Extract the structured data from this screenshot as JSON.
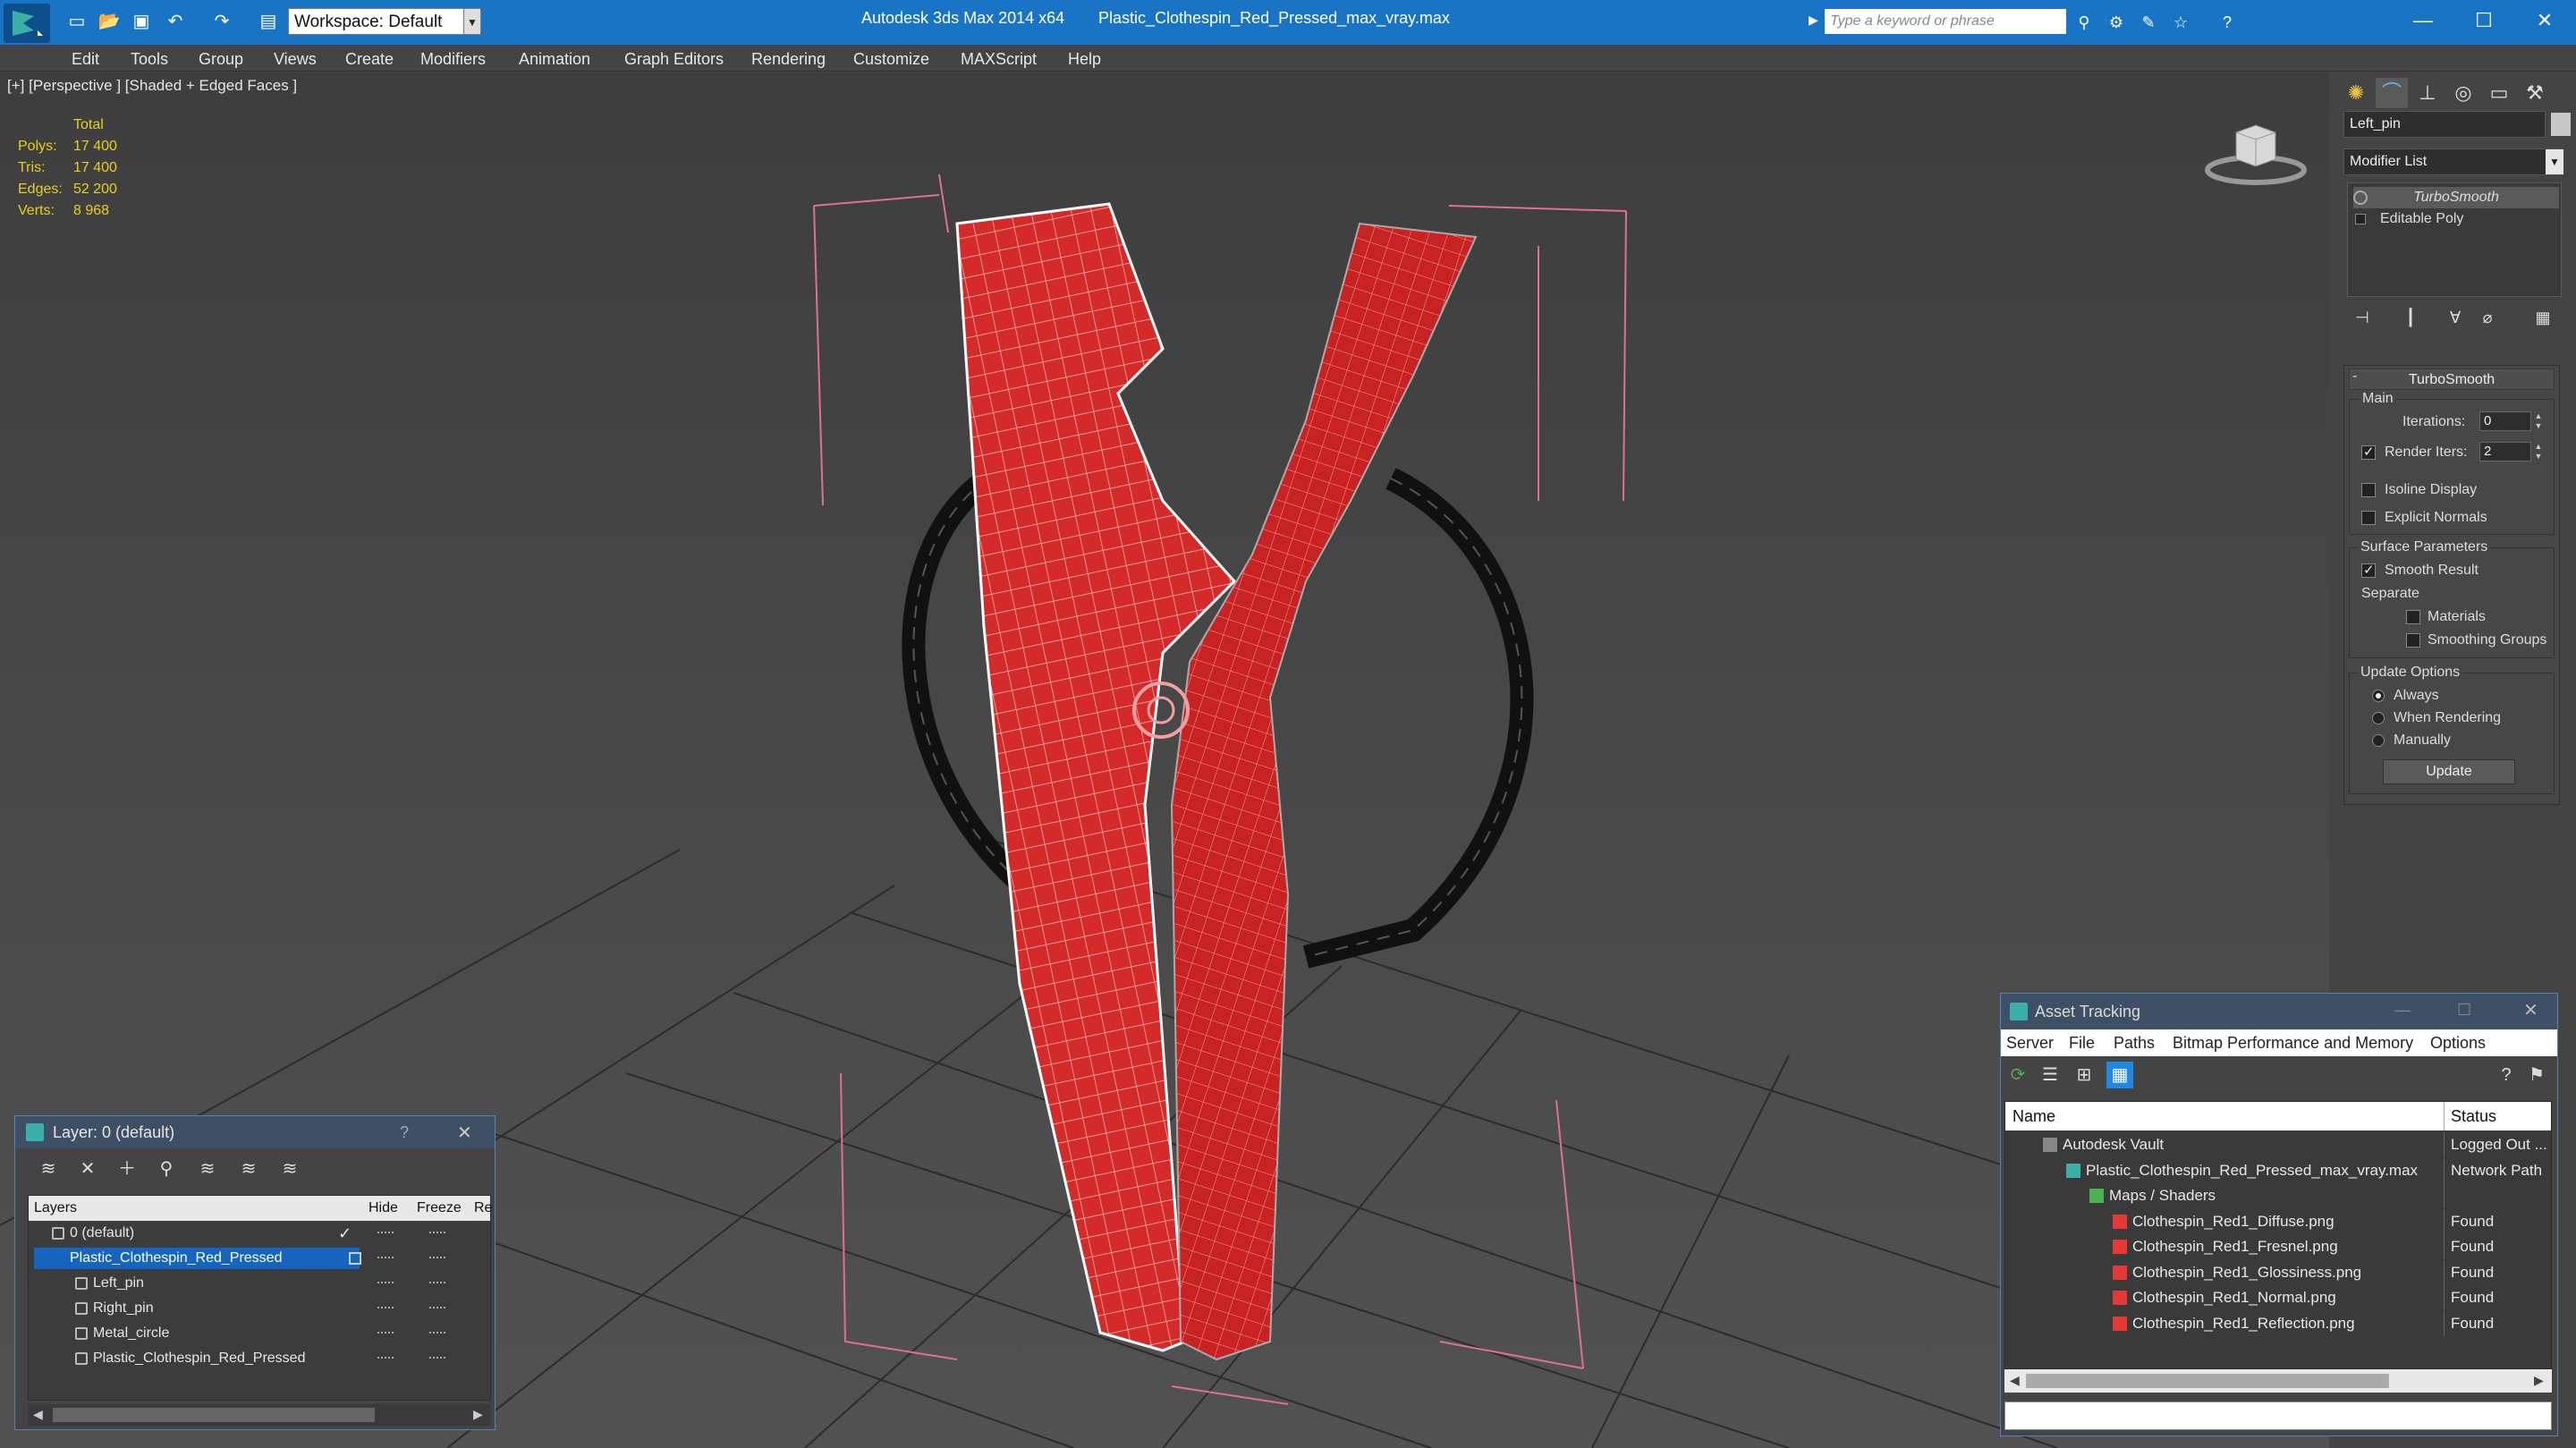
{
  "titlebar": {
    "app_title": "Autodesk 3ds Max  2014 x64",
    "file_title": "Plastic_Clothespin_Red_Pressed_max_vray.max",
    "workspace": "Workspace: Default",
    "search_placeholder": "Type a keyword or phrase"
  },
  "menu": [
    "Edit",
    "Tools",
    "Group",
    "Views",
    "Create",
    "Modifiers",
    "Animation",
    "Graph Editors",
    "Rendering",
    "Customize",
    "MAXScript",
    "Help"
  ],
  "viewport": {
    "label": "[+] [Perspective ] [Shaded + Edged Faces ]",
    "stats": {
      "header": "Total",
      "rows": [
        {
          "label": "Polys:",
          "value": "17 400"
        },
        {
          "label": "Tris:",
          "value": "17 400"
        },
        {
          "label": "Edges:",
          "value": "52 200"
        },
        {
          "label": "Verts:",
          "value": "8 968"
        }
      ]
    }
  },
  "command_panel": {
    "object_name": "Left_pin",
    "modifier_list": "Modifier List",
    "stack": [
      "TurboSmooth",
      "Editable Poly"
    ],
    "rollout": {
      "title": "TurboSmooth",
      "main_label": "Main",
      "iterations_label": "Iterations:",
      "iterations_value": "0",
      "render_iters_label": "Render Iters:",
      "render_iters_value": "2",
      "render_iters_checked": true,
      "isoline_label": "Isoline Display",
      "explicit_label": "Explicit Normals",
      "surface_label": "Surface Parameters",
      "smooth_label": "Smooth Result",
      "smooth_checked": true,
      "separate_label": "Separate",
      "materials_label": "Materials",
      "smoothing_groups_label": "Smoothing Groups",
      "update_options_label": "Update Options",
      "always_label": "Always",
      "when_rendering_label": "When Rendering",
      "manually_label": "Manually",
      "update_button": "Update"
    }
  },
  "layer_window": {
    "title": "Layer: 0 (default)",
    "help": "?",
    "columns": [
      "Layers",
      "Hide",
      "Freeze",
      "Re"
    ],
    "rows": [
      {
        "name": "0 (default)",
        "indent": 0
      },
      {
        "name": "Plastic_Clothespin_Red_Pressed",
        "indent": 0,
        "selected": true
      },
      {
        "name": "Left_pin",
        "indent": 1
      },
      {
        "name": "Right_pin",
        "indent": 1
      },
      {
        "name": "Metal_circle",
        "indent": 1
      },
      {
        "name": "Plastic_Clothespin_Red_Pressed",
        "indent": 1
      }
    ]
  },
  "asset_window": {
    "title": "Asset Tracking",
    "menu": [
      "Server",
      "File",
      "Paths",
      "Bitmap Performance and Memory",
      "Options"
    ],
    "columns": [
      "Name",
      "Status"
    ],
    "rows": [
      {
        "name": "Autodesk Vault",
        "status": "Logged Out ...",
        "indent": 0
      },
      {
        "name": "Plastic_Clothespin_Red_Pressed_max_vray.max",
        "status": "Network Path",
        "indent": 1
      },
      {
        "name": "Maps / Shaders",
        "status": "",
        "indent": 2
      },
      {
        "name": "Clothespin_Red1_Diffuse.png",
        "status": "Found",
        "indent": 3
      },
      {
        "name": "Clothespin_Red1_Fresnel.png",
        "status": "Found",
        "indent": 3
      },
      {
        "name": "Clothespin_Red1_Glossiness.png",
        "status": "Found",
        "indent": 3
      },
      {
        "name": "Clothespin_Red1_Normal.png",
        "status": "Found",
        "indent": 3
      },
      {
        "name": "Clothespin_Red1_Reflection.png",
        "status": "Found",
        "indent": 3
      }
    ]
  },
  "colors": {
    "titlebar": "#1a74c6",
    "stats_text": "#e8cf1f",
    "selection": "#1565c0",
    "model_red": "#d42a2a"
  }
}
